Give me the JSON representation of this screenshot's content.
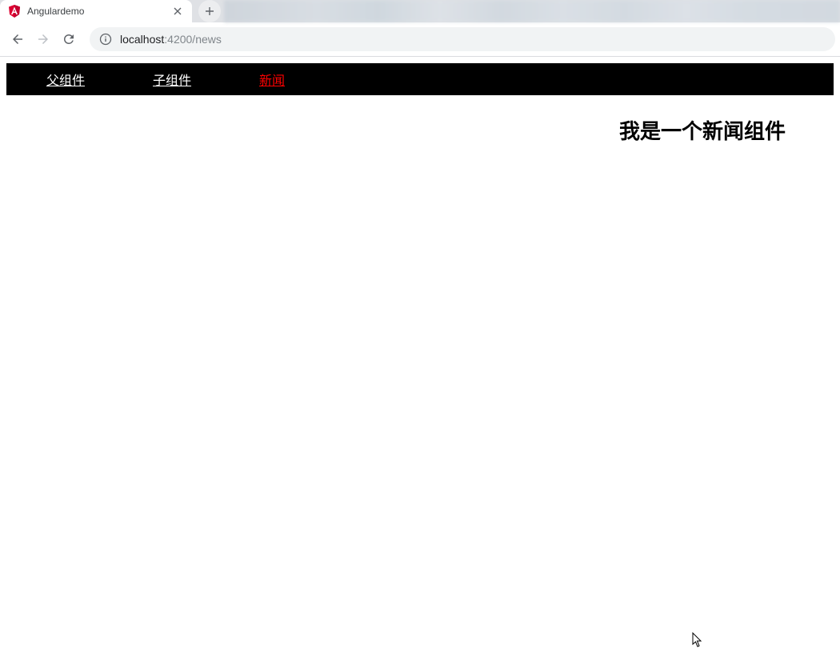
{
  "browser": {
    "tab": {
      "title": "Angulardemo",
      "favicon_letter": "A"
    },
    "url": {
      "host": "localhost",
      "port_path": ":4200/news"
    }
  },
  "nav": {
    "items": [
      {
        "label": "父组件",
        "active": false
      },
      {
        "label": "子组件",
        "active": false
      },
      {
        "label": "新闻",
        "active": true
      }
    ]
  },
  "page": {
    "heading": "我是一个新闻组件"
  }
}
